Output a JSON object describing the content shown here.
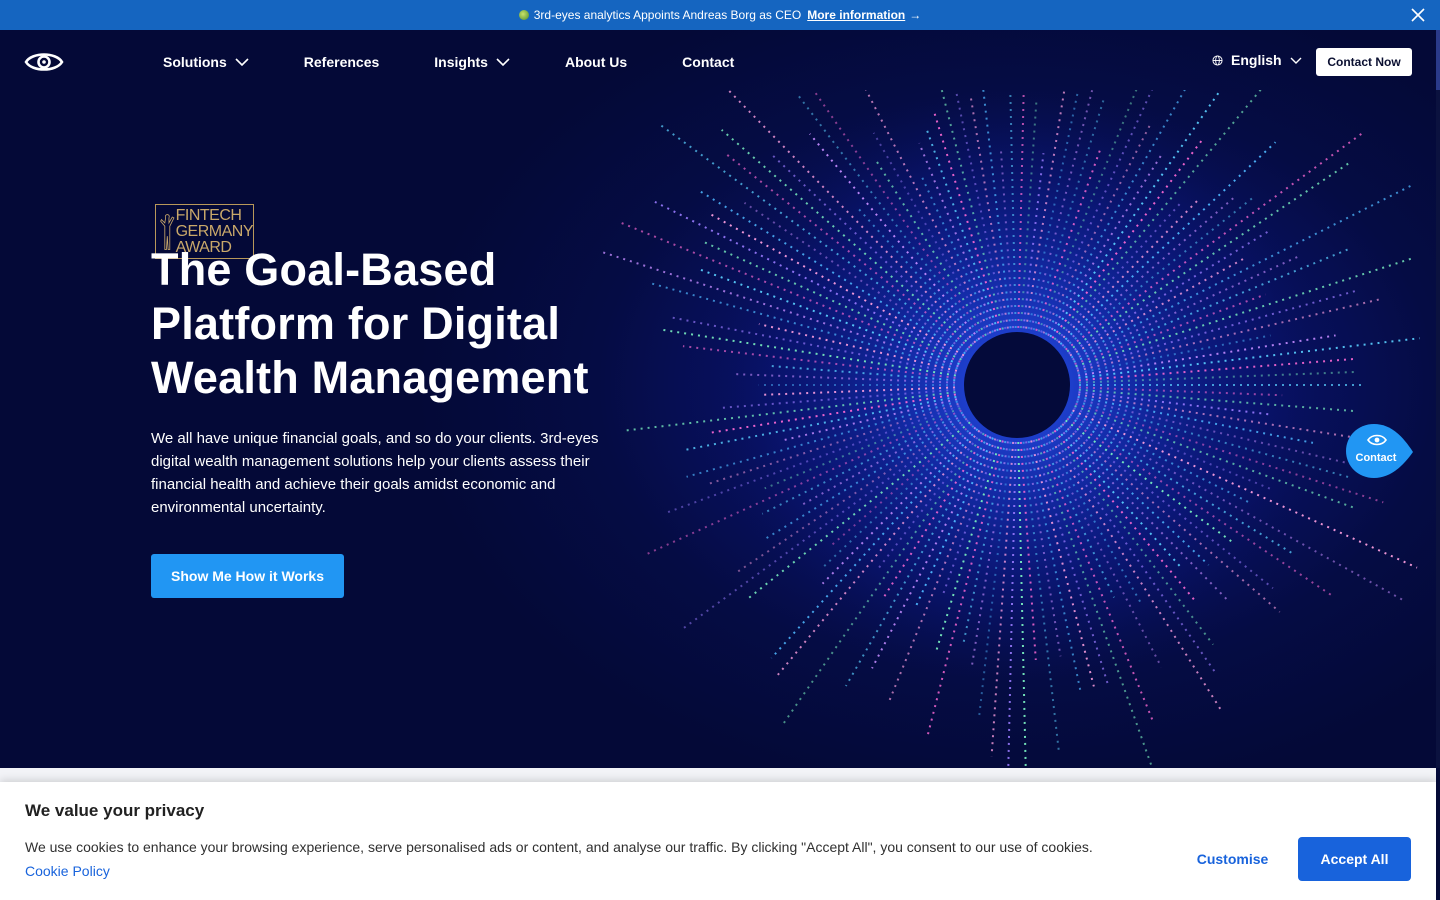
{
  "announcement": {
    "text": "3rd-eyes analytics Appoints Andreas Borg as CEO",
    "link": "More information",
    "arrow": "→",
    "icons": {
      "close": "close-icon",
      "dot": "globe-badge-icon"
    }
  },
  "nav": {
    "logo": "3rd-eyes-logo",
    "items": [
      {
        "label": "Solutions",
        "dropdown": true
      },
      {
        "label": "References",
        "dropdown": false
      },
      {
        "label": "Insights",
        "dropdown": true
      },
      {
        "label": "About Us",
        "dropdown": false
      },
      {
        "label": "Contact",
        "dropdown": false
      }
    ],
    "language": "English",
    "contact_button": "Contact Now"
  },
  "hero": {
    "award": [
      "FINTECH",
      "GERMANY",
      "AWARD"
    ],
    "headline": [
      "The Goal-Based",
      "Platform for Digital",
      "Wealth Management"
    ],
    "lead": "We all have unique financial goals, and so do your clients. 3rd-eyes digital wealth management solutions help your clients assess their financial health and achieve their goals amidst economic and environmental uncertainty.",
    "cta": "Show Me How it Works"
  },
  "floating_contact": {
    "label": "Contact",
    "icon": "eye-icon"
  },
  "cookie": {
    "title": "We value your privacy",
    "text": "We use cookies to enhance your browsing experience, serve personalised ads or content, and analyse our traffic. By clicking \"Accept All\", you consent to our use of cookies.",
    "policy_link": "Cookie Policy",
    "customise": "Customise",
    "accept": "Accept All"
  },
  "colors": {
    "announcement_bg": "#1565c0",
    "hero_bg": "#050b3a",
    "cta": "#2196f3",
    "cookie_accent": "#1863dc"
  }
}
